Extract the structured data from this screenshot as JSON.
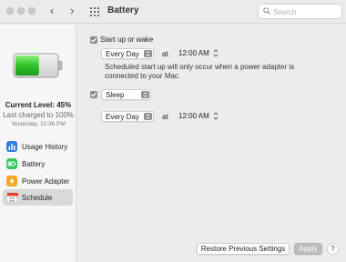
{
  "window": {
    "title": "Battery",
    "search": {
      "placeholder": "Search",
      "value": ""
    }
  },
  "sidebar": {
    "current_level": "Current Level: 45%",
    "last_charged": "Last charged to 100%",
    "charged_time": "Yesterday, 10:36 PM",
    "battery_level": 0.45,
    "items": [
      {
        "label": "Usage History",
        "icon": "bar-chart-icon",
        "color": "#2f7fe0"
      },
      {
        "label": "Battery",
        "icon": "battery-icon",
        "color": "#34c759"
      },
      {
        "label": "Power Adapter",
        "icon": "bolt-icon",
        "color": "#f5a623"
      },
      {
        "label": "Schedule",
        "icon": "calendar-icon",
        "color": "#e0412f",
        "selected": true
      }
    ]
  },
  "schedule": {
    "startup": {
      "label": "Start up or wake",
      "checked": true,
      "repeat": "Every Day",
      "at": "at",
      "time": "12:00 AM",
      "note": "Scheduled start up will only occur when a power adapter is connected to your Mac."
    },
    "sleep": {
      "action": "Sleep",
      "checked": true,
      "repeat": "Every Day",
      "at": "at",
      "time": "12:00 AM"
    }
  },
  "footer": {
    "restore_label": "Restore Previous Settings",
    "apply_label": "Apply",
    "help_label": "?"
  }
}
